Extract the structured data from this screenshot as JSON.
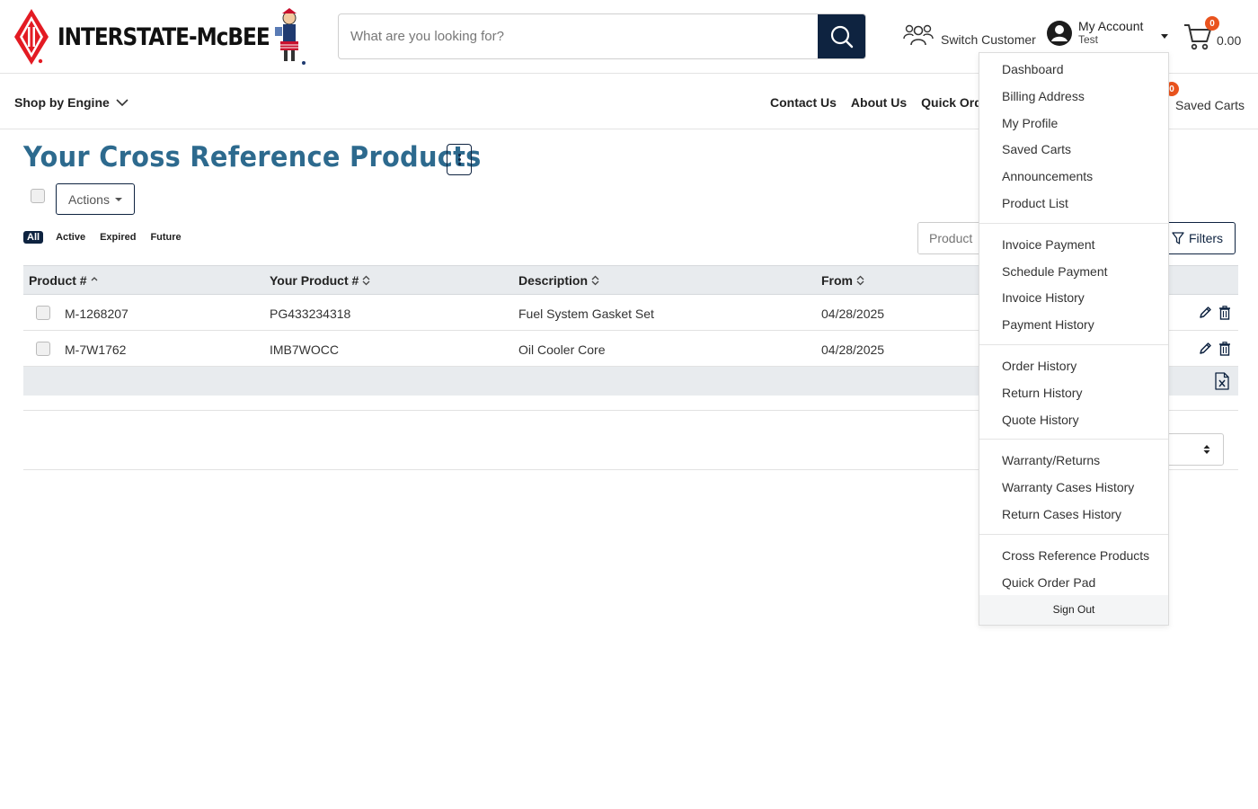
{
  "header": {
    "logo_text": "INTERSTATE-McBEE",
    "search_placeholder": "What are you looking for?",
    "switch_customer": "Switch Customer",
    "account_title": "My Account",
    "account_user": "Test",
    "cart_count": "0",
    "cart_total": "0.00"
  },
  "nav": {
    "shop_by_engine": "Shop by Engine",
    "links": [
      "Contact Us",
      "About Us",
      "Quick Ord"
    ],
    "saved_carts": "Saved Carts",
    "saved_count": "0"
  },
  "page": {
    "title": "Your Cross Reference Products",
    "actions_label": "Actions",
    "tabs": [
      "All",
      "Active",
      "Expired",
      "Future"
    ],
    "active_tab": "All",
    "filter_placeholder": "Product",
    "filters_label": "Filters"
  },
  "table": {
    "columns": [
      "Product #",
      "Your Product #",
      "Description",
      "From"
    ],
    "rows": [
      {
        "product": "M-1268207",
        "your_product": "PG433234318",
        "description": "Fuel System Gasket Set",
        "from": "04/28/2025"
      },
      {
        "product": "M-7W1762",
        "your_product": "IMB7WOCC",
        "description": "Oil Cooler Core",
        "from": "04/28/2025"
      }
    ]
  },
  "account_menu": {
    "groups": [
      [
        "Dashboard",
        "Billing Address",
        "My Profile",
        "Saved Carts",
        "Announcements",
        "Product List"
      ],
      [
        "Invoice Payment",
        "Schedule Payment",
        "Invoice History",
        "Payment History"
      ],
      [
        "Order History",
        "Return History",
        "Quote History"
      ],
      [
        "Warranty/Returns",
        "Warranty Cases History",
        "Return Cases History"
      ],
      [
        "Cross Reference Products",
        "Quick Order Pad"
      ]
    ],
    "sign_out": "Sign Out"
  },
  "colors": {
    "brand_navy": "#0e2340",
    "title_blue": "#2d6a8e",
    "badge_orange": "#e9531e",
    "logo_red": "#e31b23"
  },
  "icons": [
    "search-icon",
    "users-icon",
    "user-circle-icon",
    "cart-icon",
    "chevron-down-icon",
    "kebab-icon",
    "filter-icon",
    "sort-icon",
    "pencil-icon",
    "trash-icon",
    "excel-icon"
  ]
}
